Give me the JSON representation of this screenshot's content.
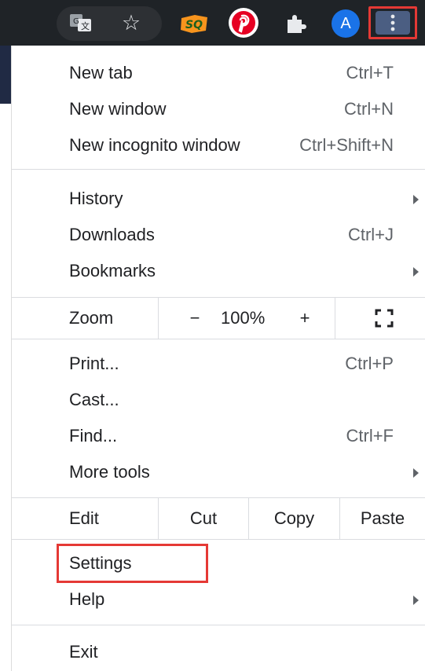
{
  "toolbar": {
    "icons": [
      "translate-icon",
      "bookmark-star-icon",
      "sq-extension-icon",
      "pinterest-icon",
      "extensions-puzzle-icon",
      "profile-avatar",
      "more-menu-icon"
    ],
    "sq_label": "SQ",
    "avatar_letter": "A",
    "colors": {
      "bar": "#1f2327",
      "avatar": "#1a73e8",
      "pinterest": "#e60023",
      "highlight": "#e53935"
    }
  },
  "menu": {
    "new_tab": {
      "label": "New tab",
      "shortcut": "Ctrl+T"
    },
    "new_window": {
      "label": "New window",
      "shortcut": "Ctrl+N"
    },
    "new_incognito": {
      "label": "New incognito window",
      "shortcut": "Ctrl+Shift+N"
    },
    "history": {
      "label": "History"
    },
    "downloads": {
      "label": "Downloads",
      "shortcut": "Ctrl+J"
    },
    "bookmarks": {
      "label": "Bookmarks"
    },
    "zoom": {
      "label": "Zoom",
      "minus": "−",
      "value": "100%",
      "plus": "+"
    },
    "print": {
      "label": "Print...",
      "shortcut": "Ctrl+P"
    },
    "cast": {
      "label": "Cast..."
    },
    "find": {
      "label": "Find...",
      "shortcut": "Ctrl+F"
    },
    "more_tools": {
      "label": "More tools"
    },
    "edit": {
      "label": "Edit",
      "cut": "Cut",
      "copy": "Copy",
      "paste": "Paste"
    },
    "settings": {
      "label": "Settings"
    },
    "help": {
      "label": "Help"
    },
    "exit": {
      "label": "Exit"
    }
  }
}
